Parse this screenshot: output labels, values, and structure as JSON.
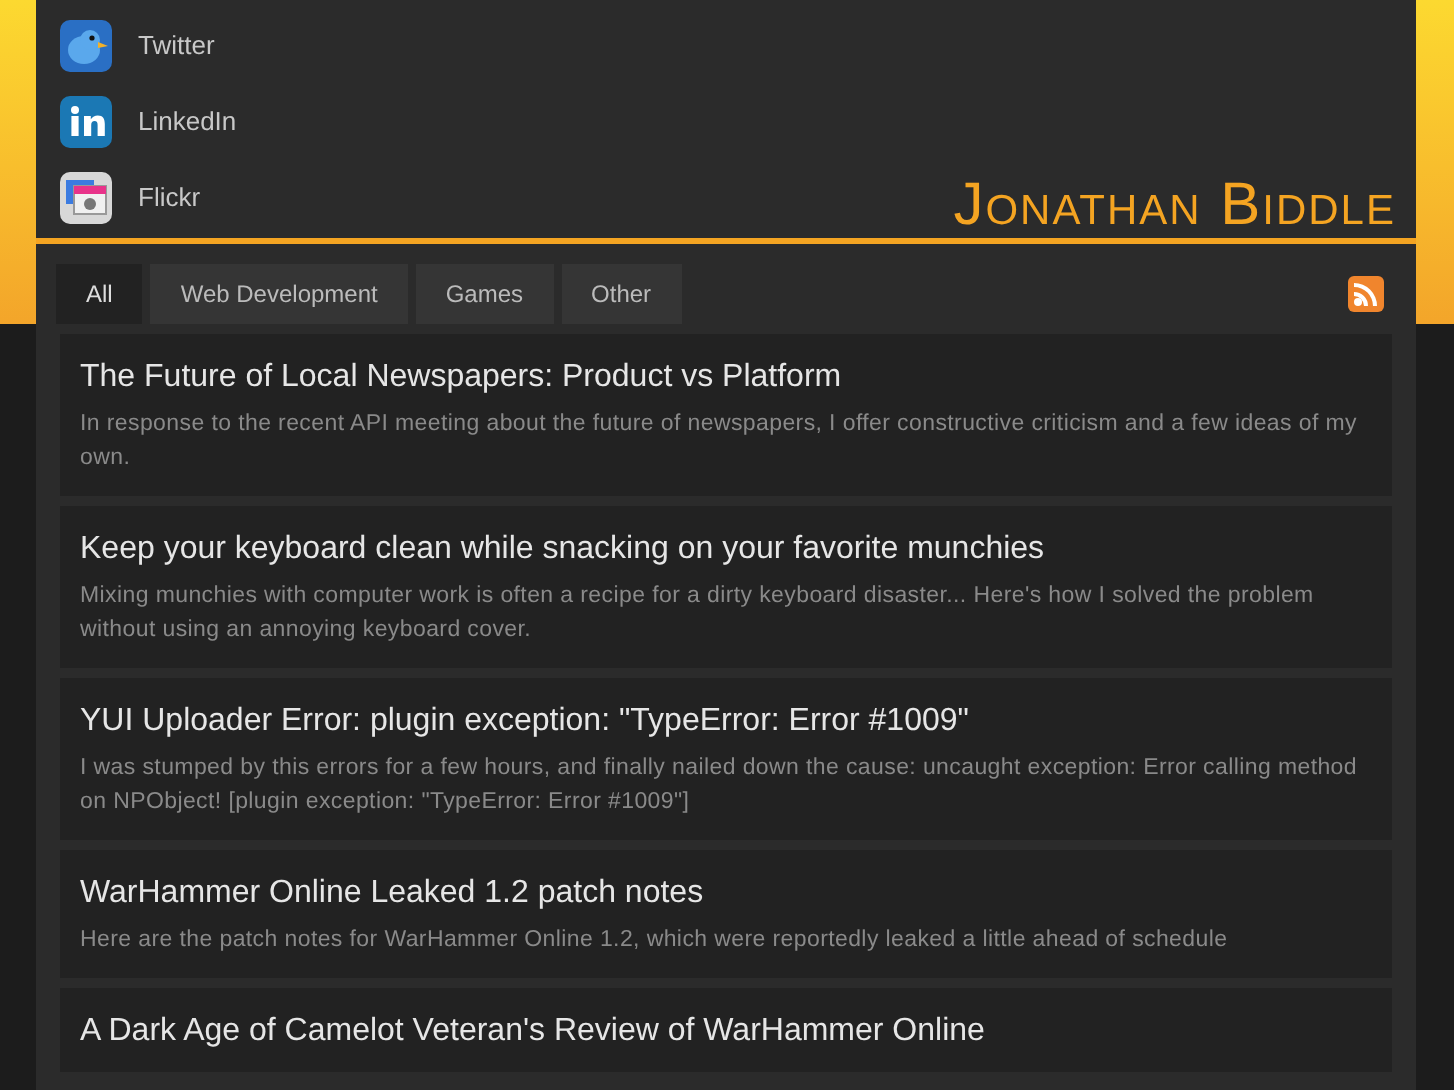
{
  "social_links": [
    {
      "kind": "twitter",
      "label": "Twitter"
    },
    {
      "kind": "linkedin",
      "label": "LinkedIn"
    },
    {
      "kind": "flickr",
      "label": "Flickr"
    }
  ],
  "site_title": "Jonathan Biddle",
  "tabs": [
    {
      "label": "All",
      "selected": true
    },
    {
      "label": "Web Development",
      "selected": false
    },
    {
      "label": "Games",
      "selected": false
    },
    {
      "label": "Other",
      "selected": false
    }
  ],
  "posts": [
    {
      "title": "The Future of Local Newspapers: Product vs Platform",
      "summary": "In response to the recent API meeting about the future of newspapers, I offer constructive criticism and a few ideas of my own."
    },
    {
      "title": "Keep your keyboard clean while snacking on your favorite munchies",
      "summary": "Mixing munchies with computer work is often a recipe for a dirty keyboard disaster... Here's how I solved the problem without using an annoying keyboard cover."
    },
    {
      "title": "YUI Uploader Error: plugin exception: \"TypeError: Error #1009\"",
      "summary": "I was stumped by this errors for a few hours, and finally nailed down the cause: uncaught exception: Error calling method on NPObject! [plugin exception: \"TypeError: Error #1009\"]"
    },
    {
      "title": "WarHammer Online Leaked 1.2 patch notes",
      "summary": "Here are the patch notes for WarHammer Online 1.2, which were reportedly leaked a little ahead of schedule"
    },
    {
      "title": "A Dark Age of Camelot Veteran's Review of WarHammer Online"
    }
  ]
}
